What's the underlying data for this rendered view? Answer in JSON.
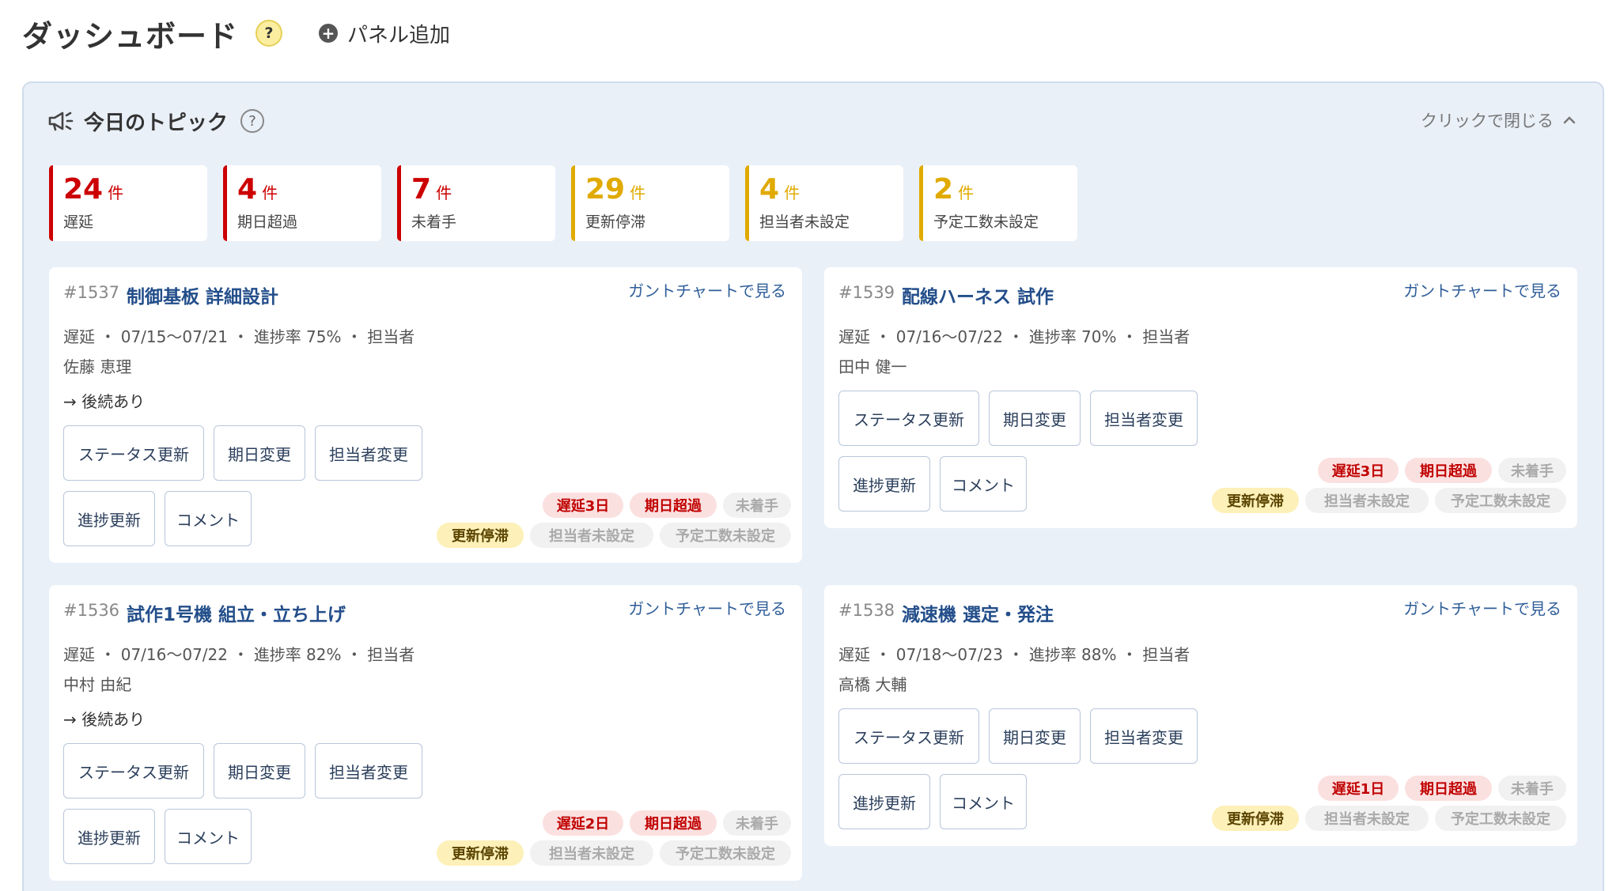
{
  "header": {
    "title": "ダッシュボード",
    "help": "?",
    "add_panel": "パネル追加"
  },
  "topic": {
    "title": "今日のトピック",
    "help": "?",
    "close_label": "クリックで閉じる"
  },
  "stats": [
    {
      "num": "24",
      "unit": "件",
      "label": "遅延",
      "color": "#cc0000"
    },
    {
      "num": "4",
      "unit": "件",
      "label": "期日超過",
      "color": "#cc0000"
    },
    {
      "num": "7",
      "unit": "件",
      "label": "未着手",
      "color": "#cc0000"
    },
    {
      "num": "29",
      "unit": "件",
      "label": "更新停滞",
      "color": "#e0aa00"
    },
    {
      "num": "4",
      "unit": "件",
      "label": "担当者未設定",
      "color": "#e0aa00"
    },
    {
      "num": "2",
      "unit": "件",
      "label": "予定工数未設定",
      "color": "#e0aa00"
    }
  ],
  "buttons": {
    "status": "ステータス更新",
    "due": "期日変更",
    "assignee": "担当者変更",
    "progress": "進捗更新",
    "comment": "コメント"
  },
  "gantt_label": "ガントチャートで見る",
  "tags_common": {
    "overdue": "期日超過",
    "not_started": "未着手",
    "stale": "更新停滞",
    "no_assignee": "担当者未設定",
    "no_estimate": "予定工数未設定"
  },
  "cards": [
    {
      "id": "#1537",
      "title": "制御基板 詳細設計",
      "meta": "遅延 ・ 07/15〜07/21 ・ 進捗率 75% ・ 担当者",
      "owner": "佐藤 恵理",
      "successor": "→ 後続あり",
      "delay_tag": "遅延3日"
    },
    {
      "id": "#1539",
      "title": "配線ハーネス 試作",
      "meta": "遅延 ・ 07/16〜07/22 ・ 進捗率 70% ・ 担当者",
      "owner": "田中 健一",
      "delay_tag": "遅延3日"
    },
    {
      "id": "#1536",
      "title": "試作1号機 組立・立ち上げ",
      "meta": "遅延 ・ 07/16〜07/22 ・ 進捗率 82% ・ 担当者",
      "owner": "中村 由紀",
      "successor": "→ 後続あり",
      "delay_tag": "遅延2日"
    },
    {
      "id": "#1538",
      "title": "減速機 選定・発注",
      "meta": "遅延 ・ 07/18〜07/23 ・ 進捗率 88% ・ 担当者",
      "owner": "高橋 大輔",
      "delay_tag": "遅延1日"
    }
  ]
}
